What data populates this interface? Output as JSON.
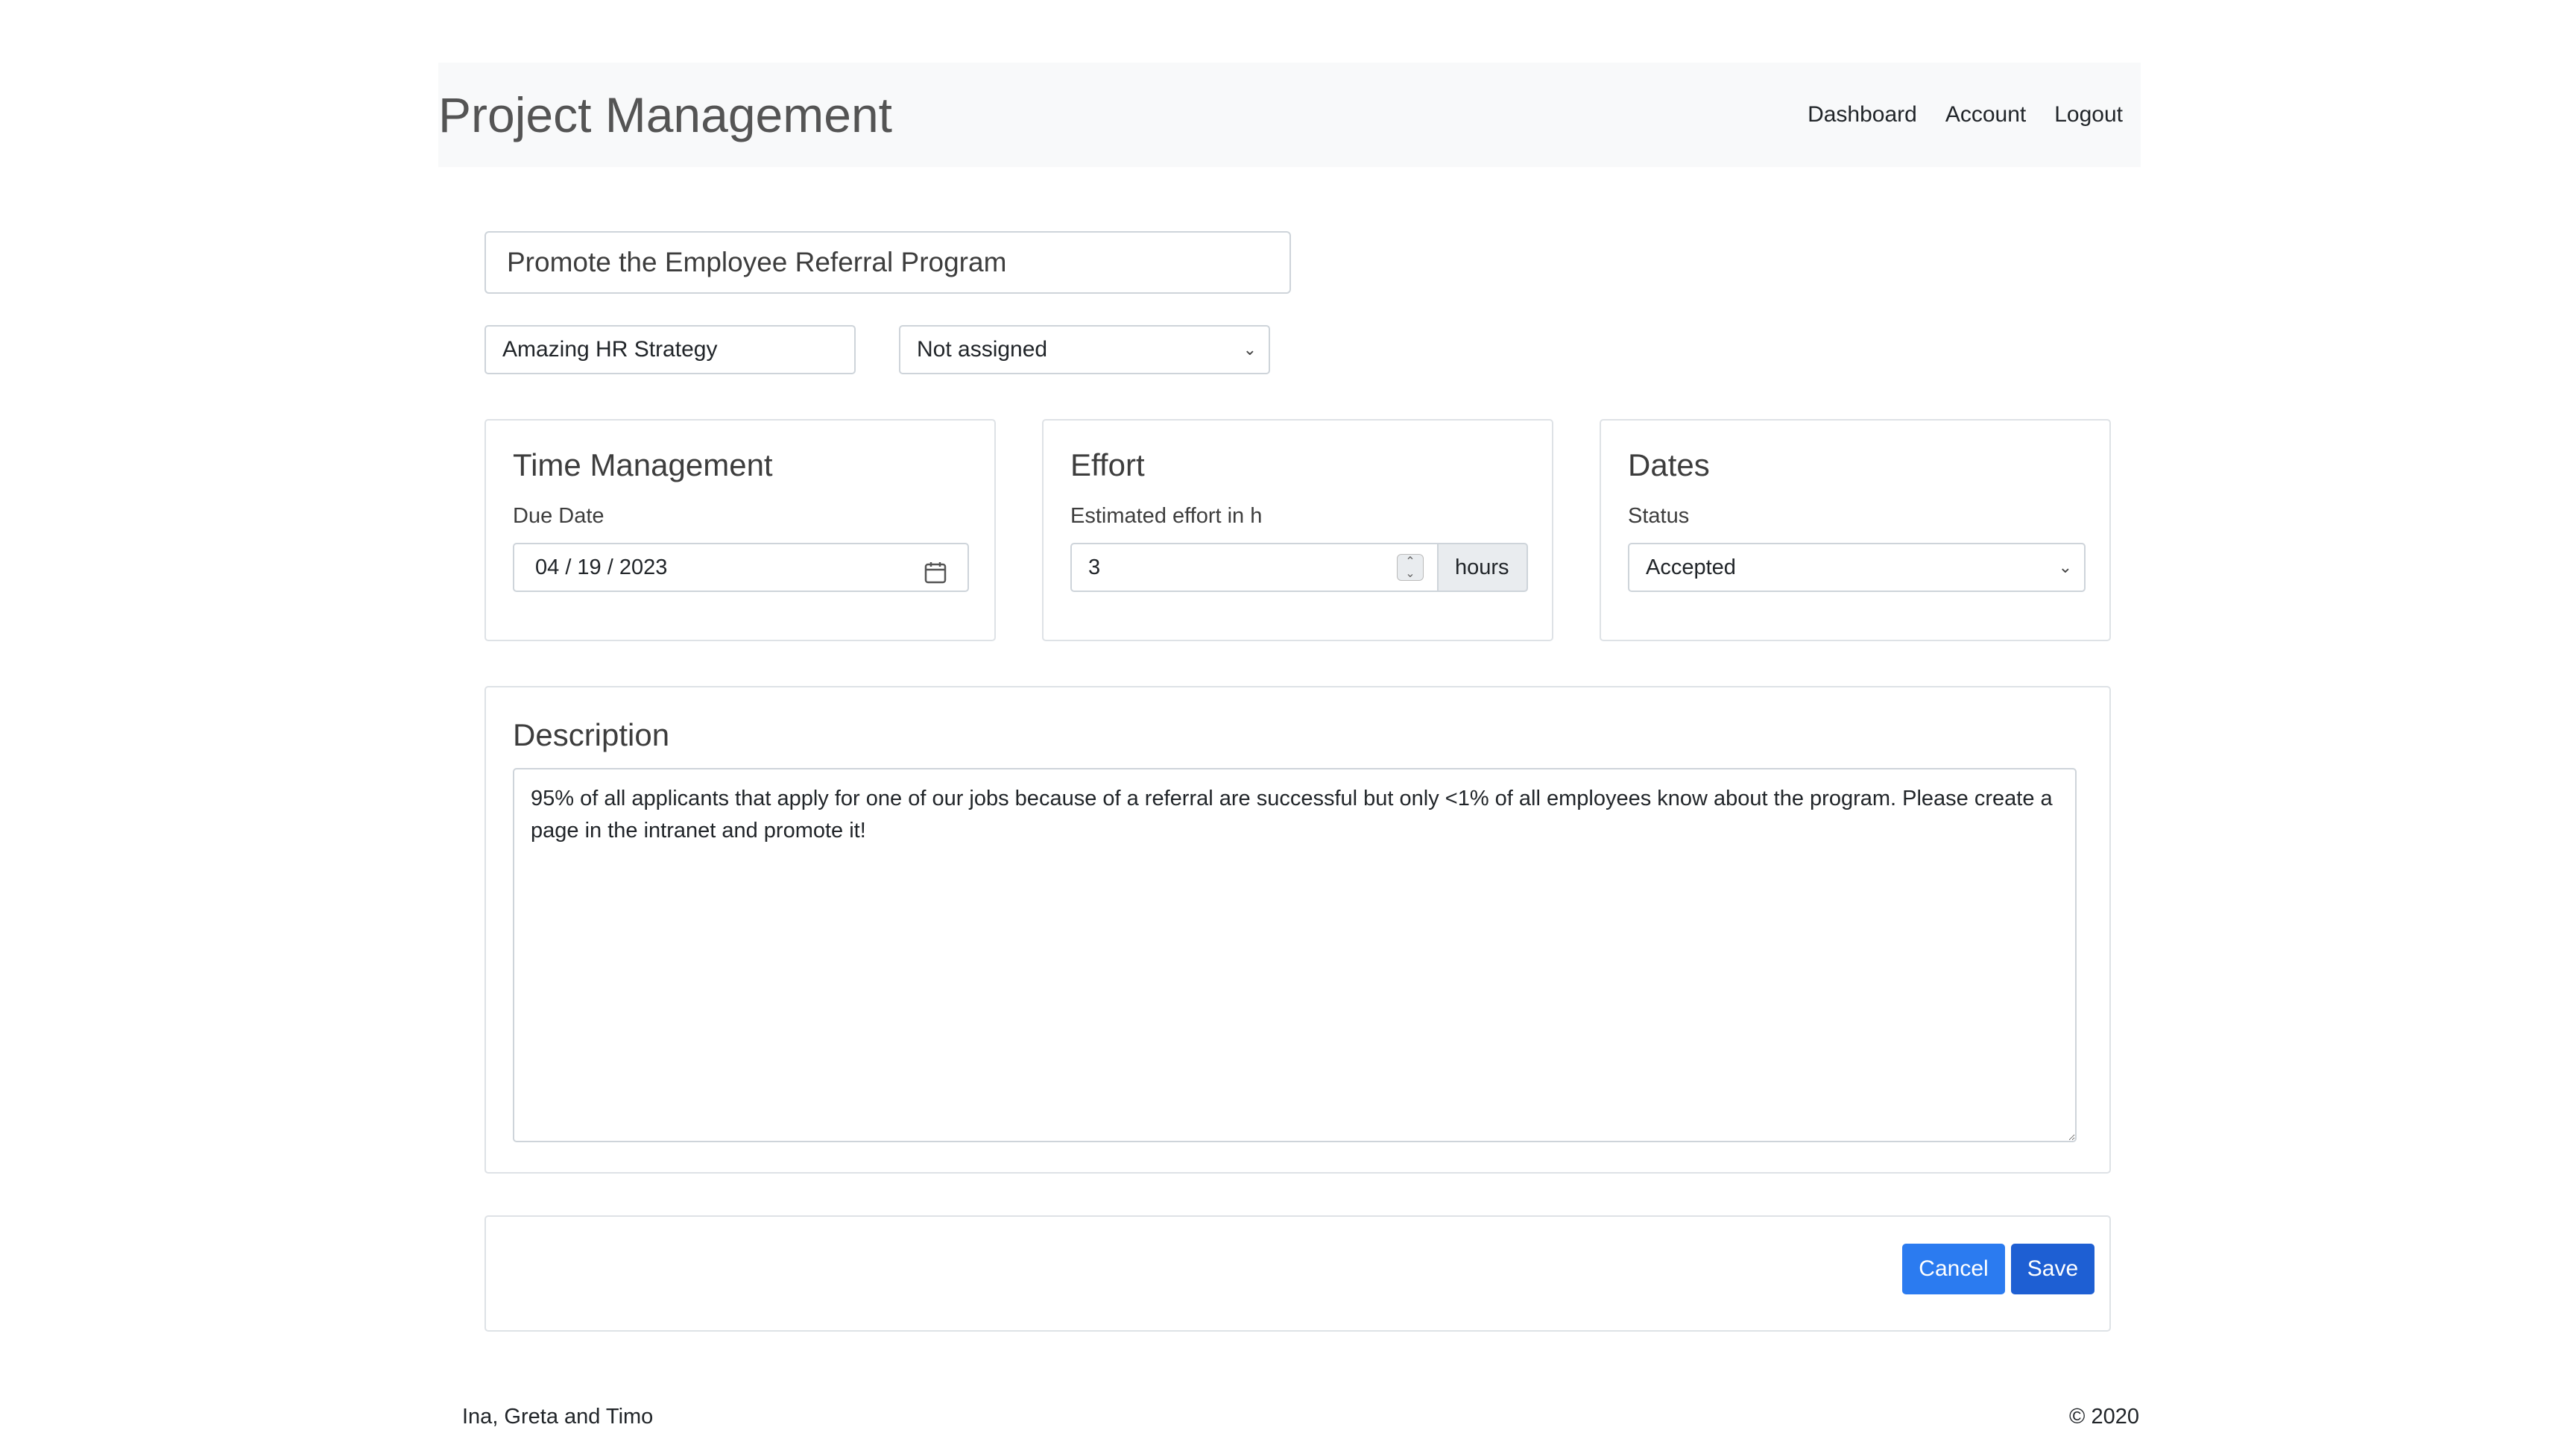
{
  "navbar": {
    "brand": "Project Management",
    "links": [
      "Dashboard",
      "Account",
      "Logout"
    ]
  },
  "task": {
    "title": "Promote the Employee Referral Program",
    "project": "Amazing HR Strategy",
    "assignee": "Not assigned"
  },
  "time_management": {
    "heading": "Time Management",
    "due_label": "Due Date",
    "due_value": "04 / 19 / 2023"
  },
  "effort": {
    "heading": "Effort",
    "label": "Estimated effort in h",
    "value": "3",
    "unit": "hours"
  },
  "dates": {
    "heading": "Dates",
    "status_label": "Status",
    "status_value": "Accepted"
  },
  "description": {
    "heading": "Description",
    "text": "95% of all applicants that apply for one of our jobs because of a referral are successful but only <1% of all employees know about the program. Please create a page in the intranet and promote it!"
  },
  "actions": {
    "cancel": "Cancel",
    "save": "Save"
  },
  "footer": {
    "authors": "Ina, Greta and Timo",
    "copyright": "© 2020"
  },
  "colors": {
    "primary": "#2b7bf0",
    "primary_dark": "#1e5fd3",
    "navbar_bg": "#f8f9fa",
    "border": "#dee2e6"
  }
}
